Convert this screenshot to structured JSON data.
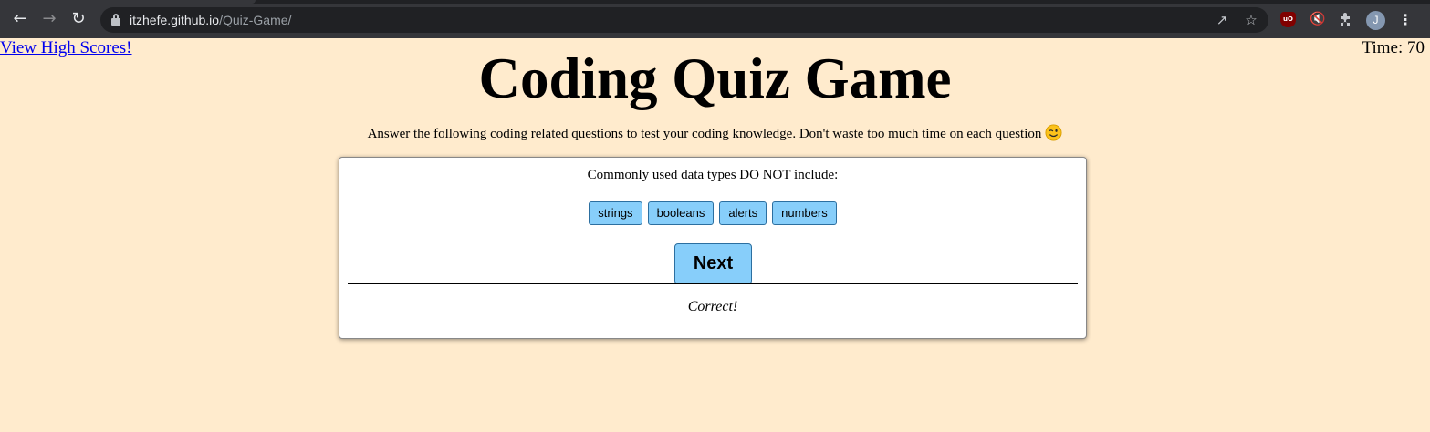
{
  "browser": {
    "url_host": "itzhefe.github.io",
    "url_path": "/Quiz-Game/",
    "profile_initial": "J",
    "ublock_label": "uO"
  },
  "page": {
    "high_scores_link": "View High Scores!",
    "timer_text": "Time: 70",
    "title": "Coding Quiz Game",
    "intro": "Answer the following coding related questions to test your coding knowledge. Don't waste too much time on each question"
  },
  "quiz": {
    "question": "Commonly used data types DO NOT include:",
    "answers": [
      "strings",
      "booleans",
      "alerts",
      "numbers"
    ],
    "next_label": "Next",
    "feedback": "Correct!"
  },
  "colors": {
    "page_background": "#ffebcd",
    "button_background": "#87cefa",
    "link": "#0000ee"
  },
  "icons": [
    "back-arrow-icon",
    "forward-arrow-icon",
    "reload-icon",
    "lock-icon",
    "share-icon",
    "star-icon",
    "ublock-icon",
    "mute-icon",
    "puzzle-icon",
    "avatar",
    "kebab-menu-icon",
    "wink-emoji-icon"
  ]
}
